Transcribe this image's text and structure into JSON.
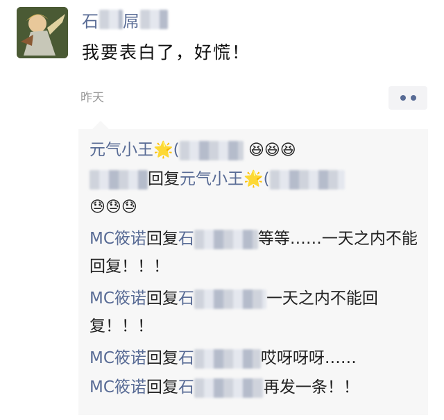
{
  "post": {
    "author": "石",
    "author_hidden": "屌",
    "content": "我要表白了，好慌！",
    "time": "昨天",
    "more_icon": "more-dots-icon"
  },
  "comments": [
    {
      "name": "元气小王🌟(",
      "text": "",
      "emoji": "😆😆😆"
    },
    {
      "name": "",
      "reply": "回复",
      "target": "元气小王🌟(",
      "text": "",
      "emoji": "😓😓😓"
    },
    {
      "name": "MC筱诺",
      "reply": "回复",
      "target": "石",
      "text": "等等……一天之内不能回复！！！"
    },
    {
      "name": "MC筱诺",
      "reply": "回复",
      "target": "石",
      "text": "一天之内不能回复！！！"
    },
    {
      "name": "MC筱诺",
      "reply": "回复",
      "target": "石",
      "text": "哎呀呀呀……"
    },
    {
      "name": "MC筱诺",
      "reply": "回复",
      "target": "石",
      "text": "再发一条！！"
    }
  ]
}
